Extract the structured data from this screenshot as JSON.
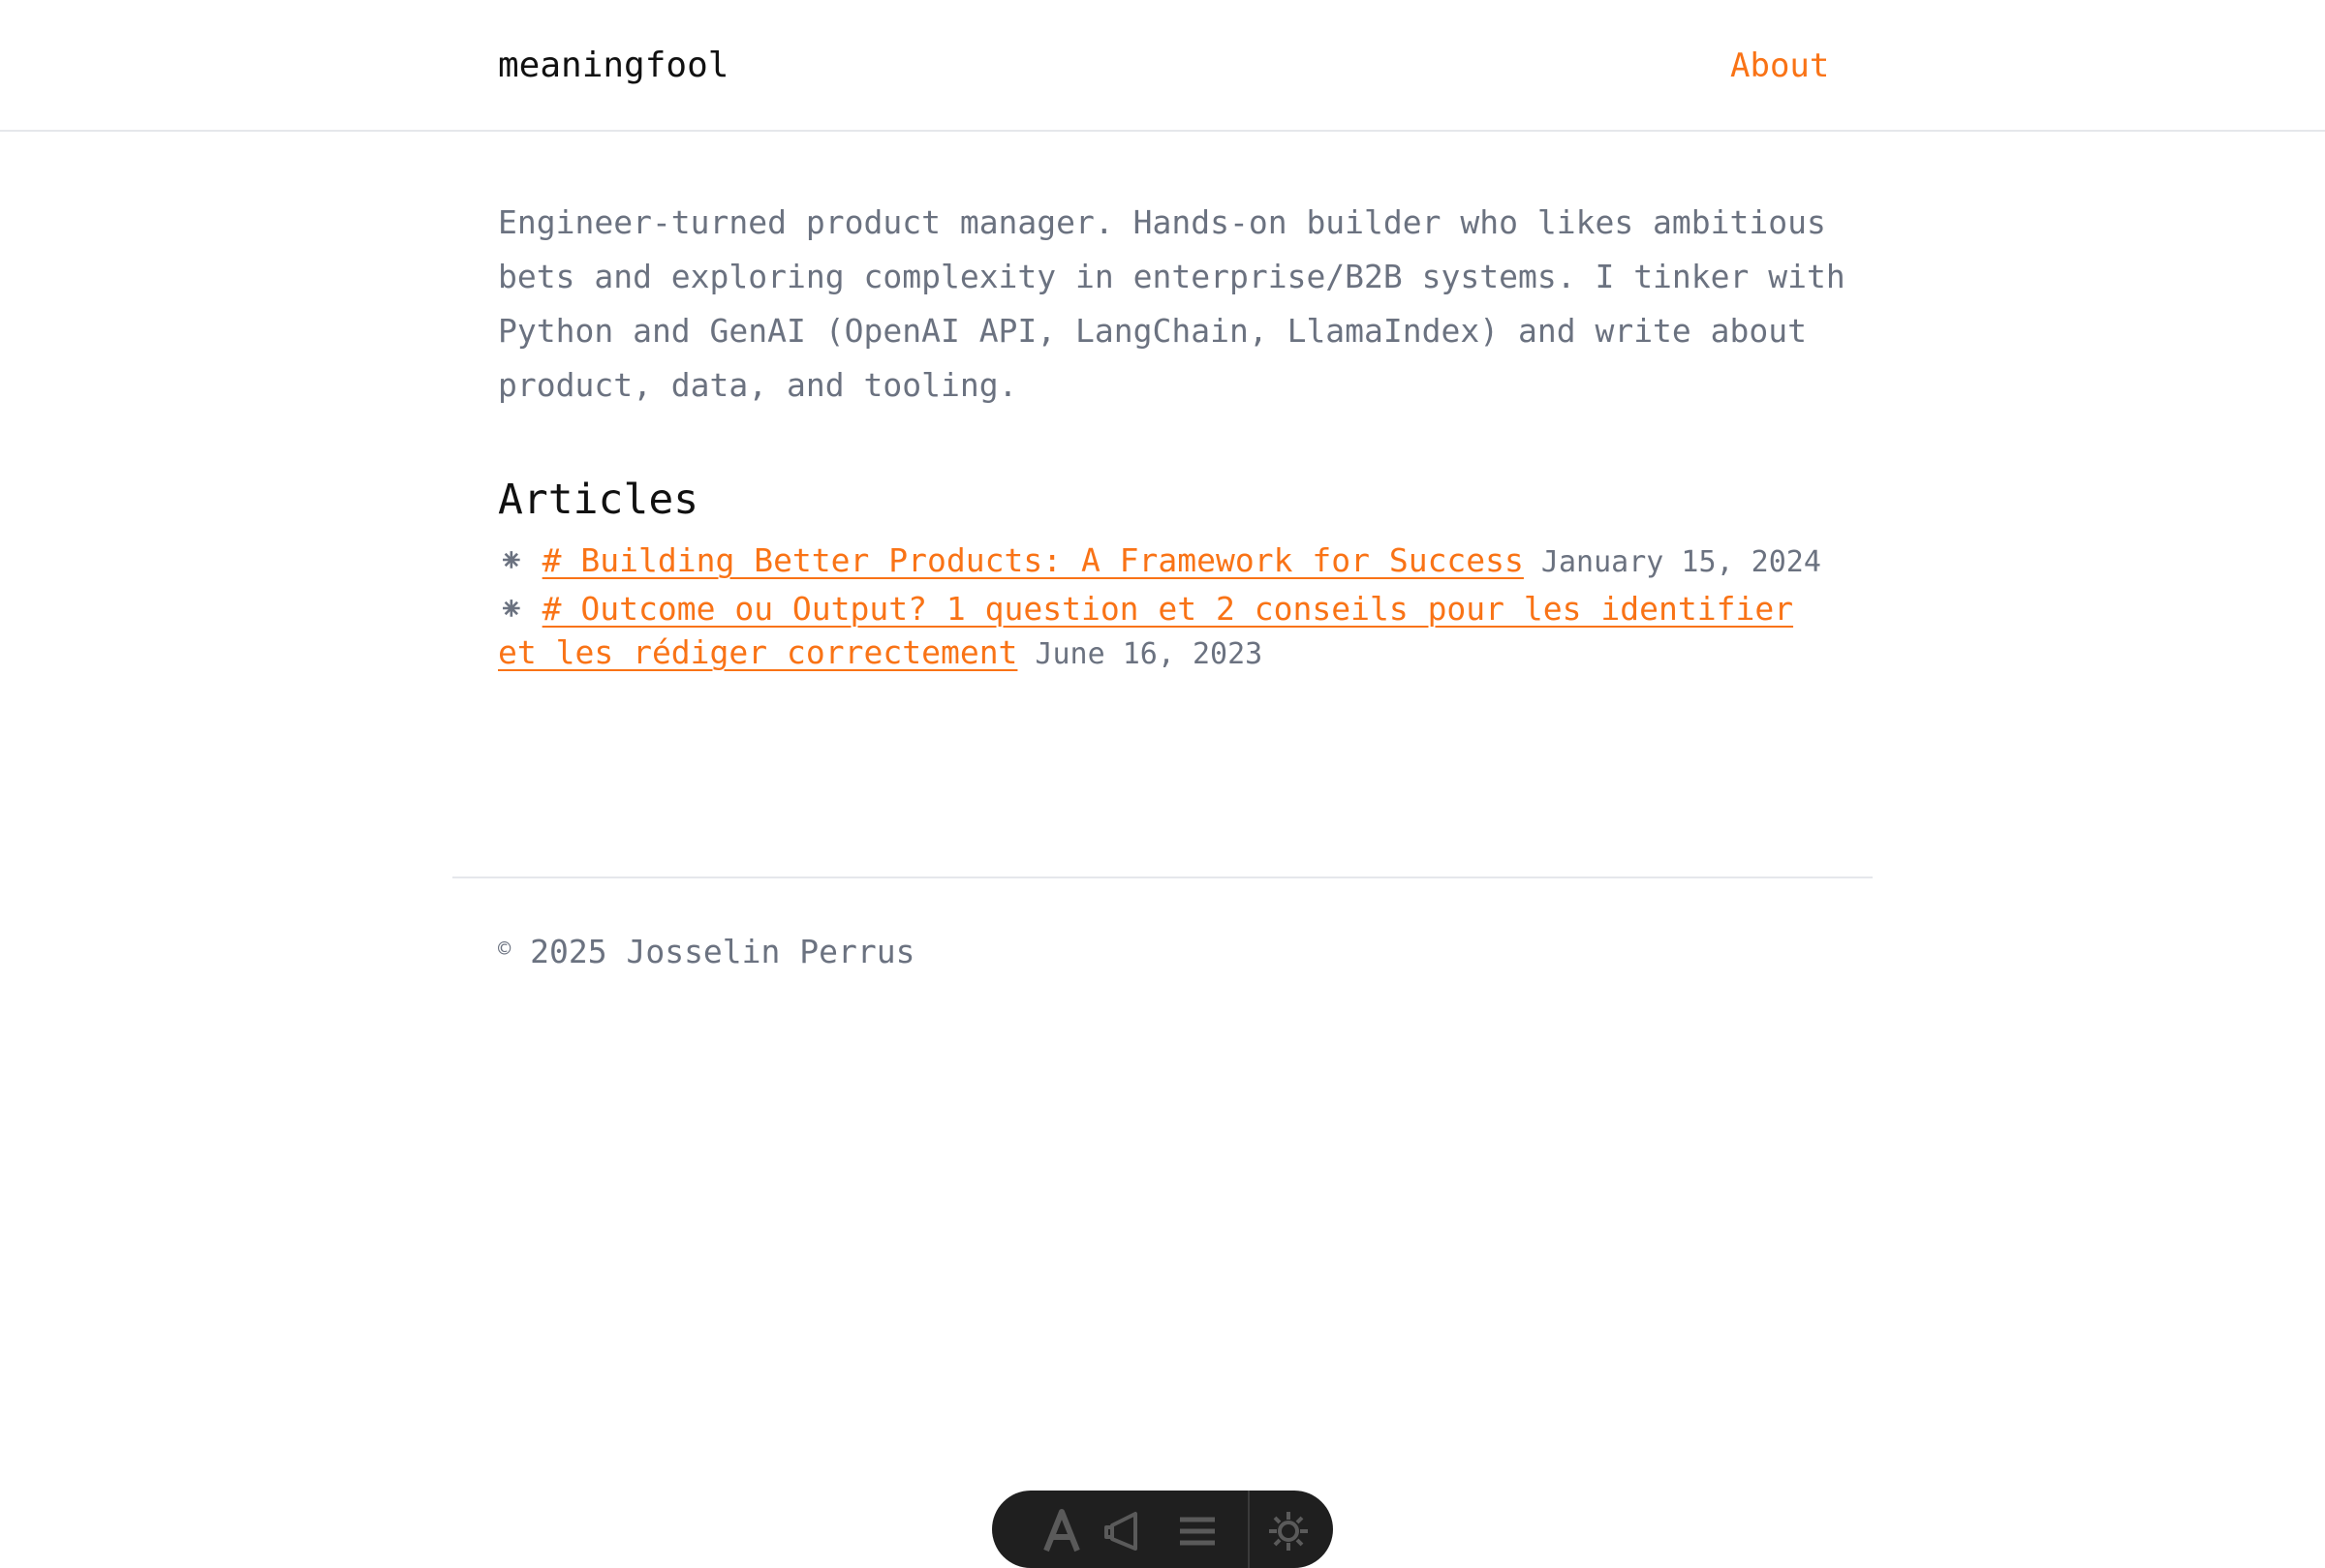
{
  "header": {
    "site_title": "meaningfool",
    "nav": {
      "about_label": "About"
    }
  },
  "bio": "Engineer-turned product manager. Hands-on builder who likes ambitious bets and exploring complexity in enterprise/B2B systems. I tinker with Python and GenAI (OpenAI API, LangChain, LlamaIndex) and write about product, data, and tooling.",
  "articles": {
    "heading": "Articles",
    "bullet": "⁕",
    "items": [
      {
        "title": "# Building Better Products: A Framework for Success",
        "date": "January 15, 2024"
      },
      {
        "title": "# Outcome ou Output? 1 question et 2 conseils pour les identifier et les rédiger correctement",
        "date": "June 16, 2023"
      }
    ]
  },
  "footer": {
    "copyright_symbol": "©",
    "text": "2025 Josselin Perrus"
  },
  "toolbar": {
    "icons": [
      "text-icon",
      "megaphone-icon",
      "menu-icon",
      "gear-icon"
    ]
  },
  "colors": {
    "accent": "#f97316",
    "text_muted": "#6b7280",
    "text_strong": "#111111",
    "divider": "#e5e7eb",
    "toolbar_bg": "#1f1f1f"
  }
}
